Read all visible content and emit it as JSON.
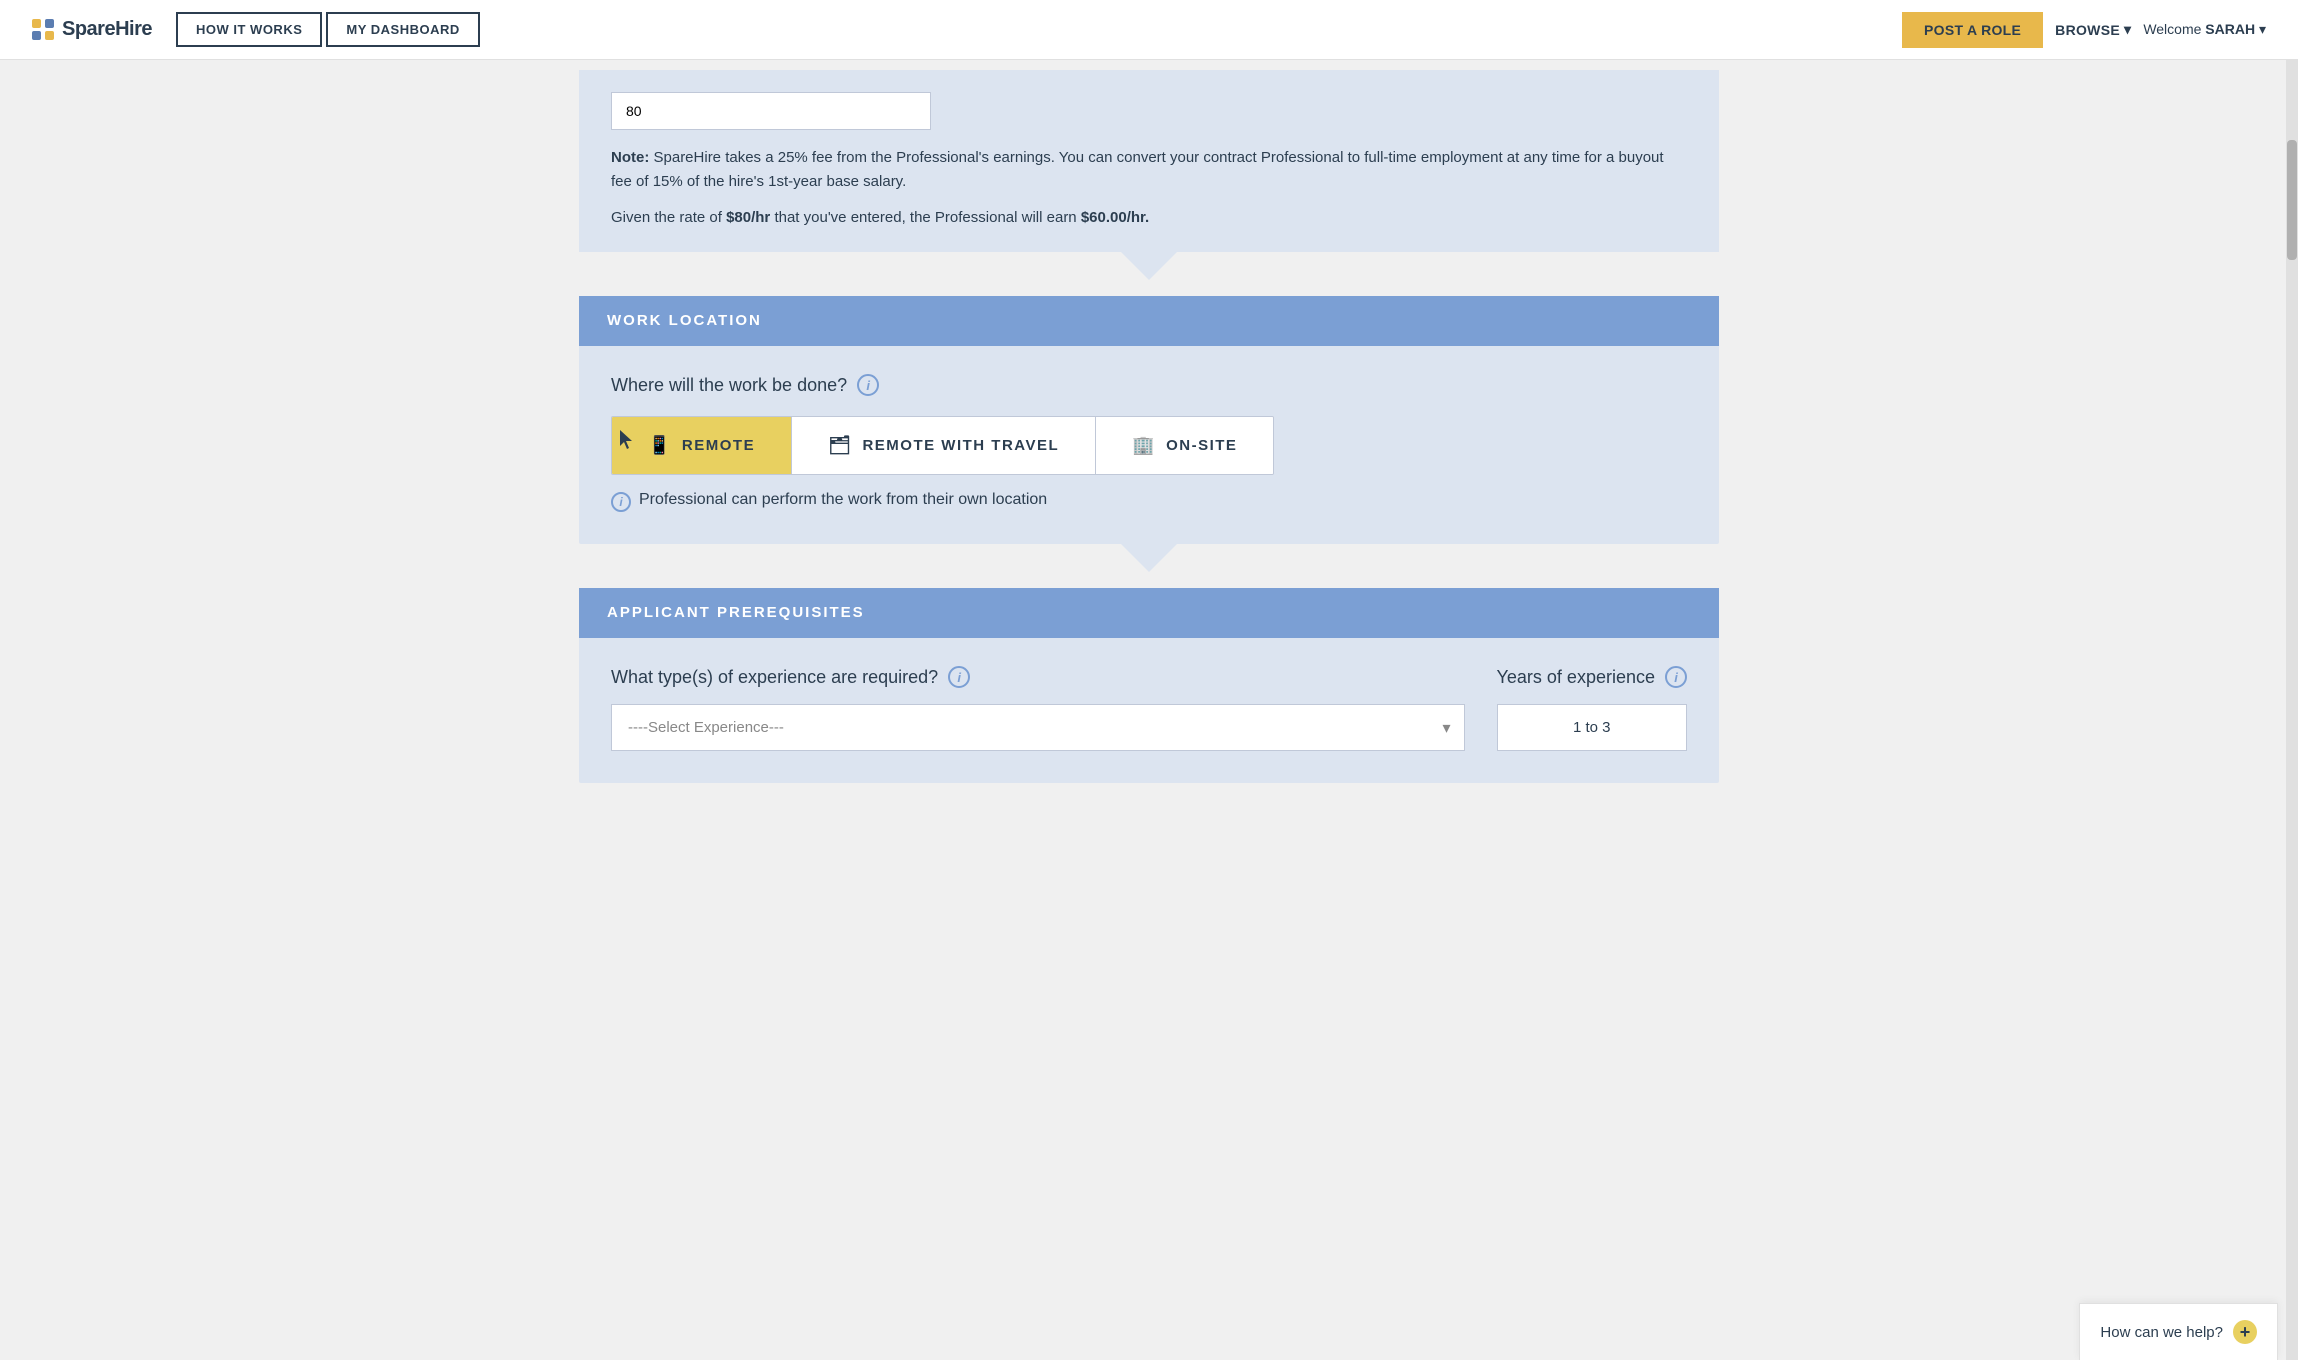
{
  "nav": {
    "logo_text": "SpareHire",
    "how_it_works": "HOW IT WORKS",
    "my_dashboard": "MY DASHBOARD",
    "post_a_role": "POST A ROLE",
    "browse": "BROWSE",
    "welcome": "Welcome",
    "user_name": "SARAH"
  },
  "note_section": {
    "note_label": "Note:",
    "note_body": "SpareHire takes a 25% fee from the Professional's earnings. You can convert your contract Professional to full-time employment at any time for a buyout fee of 15% of the hire's 1st-year base salary.",
    "rate_text_prefix": "Given the rate of ",
    "rate_entered": "$80/hr",
    "rate_text_middle": " that you've entered, the Professional will earn ",
    "rate_earned": "$60.00/hr."
  },
  "work_location": {
    "section_title": "WORK LOCATION",
    "question": "Where will the work be done?",
    "options": [
      {
        "id": "remote",
        "label": "REMOTE",
        "icon": "📱",
        "selected": true
      },
      {
        "id": "remote_travel",
        "label": "REMOTE WITH TRAVEL",
        "icon": "🗂",
        "selected": false
      },
      {
        "id": "on_site",
        "label": "ON-SITE",
        "icon": "🏢",
        "selected": false
      }
    ],
    "description": "Professional can perform the work from their own location"
  },
  "prerequisites": {
    "section_title": "APPLICANT PREREQUISITES",
    "question": "What type(s) of experience are required?",
    "select_placeholder": "----Select Experience---",
    "years_label": "Years of experience",
    "years_value": "1 to 3"
  },
  "help_widget": {
    "label": "How can we help?",
    "plus_symbol": "+"
  },
  "colors": {
    "accent_yellow": "#e8d060",
    "header_blue": "#7b9fd4",
    "bg_light_blue": "#dce4f0",
    "nav_bg": "#ffffff"
  }
}
